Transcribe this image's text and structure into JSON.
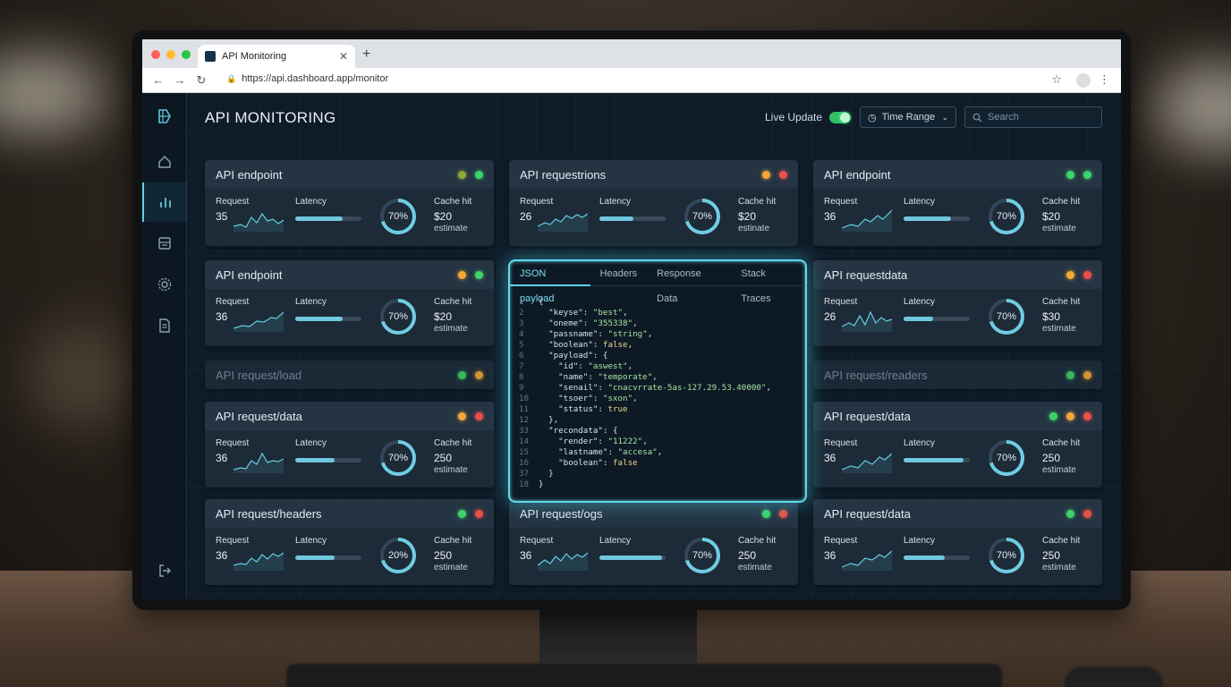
{
  "browser": {
    "tab_title": "API Monitoring",
    "tab_close": "✕",
    "new_tab": "+",
    "url": "https://api.dashboard.app/monitor"
  },
  "header": {
    "title": "API MONITORING",
    "live_update_label": "Live Update",
    "time_range_label": "Time Range",
    "search_placeholder": "Search"
  },
  "sidebar": {
    "items": [
      {
        "icon": "home-icon"
      },
      {
        "icon": "analytics-icon",
        "active": true
      },
      {
        "icon": "server-icon"
      },
      {
        "icon": "settings-icon"
      },
      {
        "icon": "document-icon"
      }
    ],
    "logout_icon": "logout-icon"
  },
  "labels": {
    "request": "Request",
    "latency": "Latency",
    "cache_hit": "Cache hit",
    "estimate": "estimate"
  },
  "colors": {
    "green": "#3ed36a",
    "amber": "#f2a838",
    "red": "#e8504a",
    "olive": "#8fa83a",
    "accent": "#5fd3e6"
  },
  "cards": [
    {
      "name": "API endpoint",
      "request": "35",
      "latency": 0.72,
      "ring": "70%",
      "ring_frac": 0.7,
      "cache": "$20",
      "sub": "estimate",
      "leds": [
        "olive",
        "green"
      ]
    },
    {
      "name": "API requestrions",
      "request": "26",
      "latency": 0.52,
      "ring": "70%",
      "ring_frac": 0.7,
      "cache": "$20",
      "sub": "estinate",
      "leds": [
        "amber",
        "red"
      ]
    },
    {
      "name": "API endpoint",
      "request": "36",
      "latency": 0.72,
      "ring": "70%",
      "ring_frac": 0.7,
      "cache": "$20",
      "sub": "estimate",
      "leds": [
        "green",
        "green"
      ]
    },
    {
      "name": "API endpoint",
      "request": "36",
      "latency": 0.72,
      "ring": "70%",
      "ring_frac": 0.7,
      "cache": "$20",
      "sub": "estimate",
      "leds": [
        "amber",
        "green"
      ]
    },
    {
      "name": "API requestdata",
      "request": "26",
      "latency": 0.45,
      "ring": "70%",
      "ring_frac": 0.7,
      "cache": "$30",
      "sub": "estimate",
      "leds": [
        "amber",
        "red"
      ]
    },
    {
      "name": "API request/data",
      "request": "36",
      "latency": 0.6,
      "ring": "70%",
      "ring_frac": 0.7,
      "cache": "250",
      "sub": "estimate",
      "leds": [
        "amber",
        "red"
      ]
    },
    {
      "name": "API request/data",
      "request": "36",
      "latency": 0.9,
      "ring": "70%",
      "ring_frac": 0.7,
      "cache": "250",
      "sub": "estimate",
      "leds": [
        "green",
        "amber",
        "red"
      ]
    },
    {
      "name": "API request/headers",
      "request": "36",
      "latency": 0.6,
      "ring": "20%",
      "ring_frac": 0.7,
      "cache": "250",
      "sub": "estimate",
      "leds": [
        "green",
        "red"
      ]
    },
    {
      "name": "API request/ogs",
      "request": "36",
      "latency": 0.95,
      "ring": "70%",
      "ring_frac": 0.7,
      "cache": "250",
      "sub": "estimate",
      "leds": [
        "green",
        "red"
      ]
    },
    {
      "name": "API request/data",
      "request": "36",
      "latency": 0.62,
      "ring": "70%",
      "ring_frac": 0.7,
      "cache": "250",
      "sub": "estimate",
      "leds": [
        "green",
        "red"
      ]
    }
  ],
  "mini_cards": [
    {
      "name": "API request/load",
      "leds": [
        "green",
        "amber"
      ]
    },
    {
      "name": "API request/readers",
      "leds": [
        "green",
        "amber"
      ]
    }
  ],
  "code_panel": {
    "tabs": [
      "JSON payload",
      "Headers",
      "Response Data",
      "Stack Traces"
    ],
    "lines": [
      {
        "n": "1",
        "t": "{"
      },
      {
        "n": "2",
        "t": "  \"keyse\": \"best\","
      },
      {
        "n": "3",
        "t": "  \"oneme\": \"355338\","
      },
      {
        "n": "4",
        "t": "  \"passname\": \"string\","
      },
      {
        "n": "5",
        "t": "  \"boolean\": false,"
      },
      {
        "n": "6",
        "t": "  \"payload\": {"
      },
      {
        "n": "7",
        "t": "    \"id\": \"aswest\","
      },
      {
        "n": "8",
        "t": "    \"name\": \"temporate\","
      },
      {
        "n": "9",
        "t": "    \"senail\": \"cnacvrrate-5as-127.29.53.40000\","
      },
      {
        "n": "10",
        "t": "    \"tsoer\": \"sxon\","
      },
      {
        "n": "11",
        "t": "    \"status\": true"
      },
      {
        "n": "12",
        "t": "  },"
      },
      {
        "n": "33",
        "t": "  \"recondata\": {"
      },
      {
        "n": "14",
        "t": "    \"render\": \"11222\","
      },
      {
        "n": "15",
        "t": "    \"lastname\": \"accesa\","
      },
      {
        "n": "16",
        "t": "    \"boolean\": false"
      },
      {
        "n": "37",
        "t": "  }"
      },
      {
        "n": "18",
        "t": "}"
      }
    ]
  }
}
